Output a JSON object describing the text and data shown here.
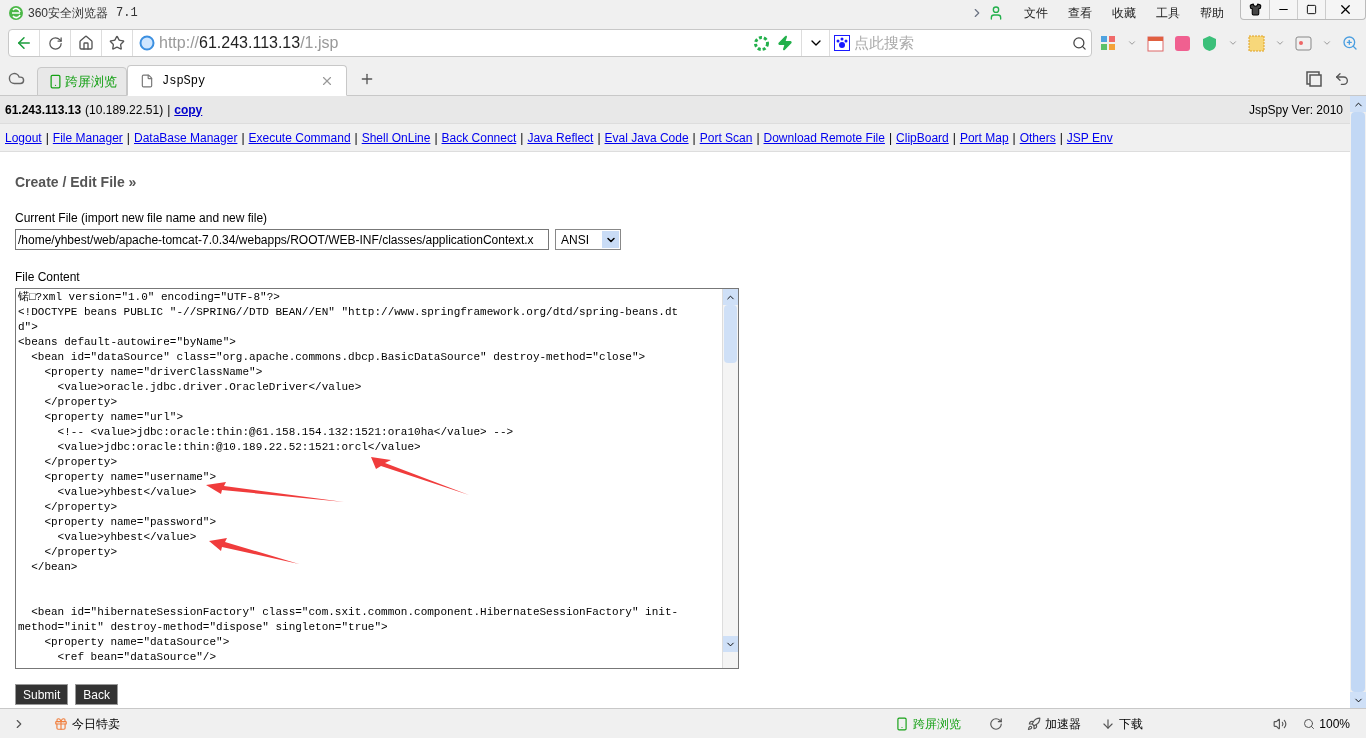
{
  "window": {
    "title": "360安全浏览器",
    "version": "7.1",
    "menu": [
      "文件",
      "查看",
      "收藏",
      "工具",
      "帮助"
    ]
  },
  "address_bar": {
    "scheme": "http://",
    "host": "61.243.113.13",
    "path": "/1.jsp"
  },
  "search": {
    "placeholder": "点此搜索"
  },
  "tabs": [
    {
      "label": "跨屏浏览",
      "kind": "cross",
      "selected": false
    },
    {
      "label": "JspSpy",
      "kind": "page",
      "selected": true
    }
  ],
  "page": {
    "header": {
      "host": "61.243.113.13",
      "ip": "(10.189.22.51)",
      "separator": "|",
      "copy_link": "copy",
      "version": "JspSpy Ver: 2010"
    },
    "nav_links": [
      "Logout",
      "File Manager",
      "DataBase Manager",
      "Execute Command",
      "Shell OnLine",
      "Back Connect",
      "Java Reflect",
      "Eval Java Code",
      "Port Scan",
      "Download Remote File",
      "ClipBoard",
      "Port Map",
      "Others",
      "JSP Env"
    ],
    "nav_separator": "|",
    "form": {
      "title": "Create / Edit File »",
      "file_label": "Current File (import new file name and new file)",
      "file_value": "/home/yhbest/web/apache-tomcat-7.0.34/webapps/ROOT/WEB-INF/classes/applicationContext.x",
      "encoding": "ANSI",
      "content_label": "File Content",
      "content_blocks": [
        [
          "锘□?xml version=\"1.0\" encoding=\"UTF-8\"?>",
          "<!DOCTYPE beans PUBLIC \"-//SPRING//DTD BEAN//EN\" \"http://www.springframework.org/dtd/spring-beans.dt",
          "d\">",
          "<beans default-autowire=\"byName\">",
          "  <bean id=\"dataSource\" class=\"org.apache.commons.dbcp.BasicDataSource\" destroy-method=\"close\">",
          "    <property name=\"driverClassName\">",
          "      <value>oracle.jdbc.driver.OracleDriver</value>",
          "    </property>",
          "    <property name=\"url\">",
          "      <!-- <value>jdbc:oracle:thin:@61.158.154.132:1521:ora10ha</value> -->",
          "      <value>jdbc:oracle:thin:@10.189.22.52:1521:orcl</value>",
          "    </property>",
          "    <property name=\"username\">",
          "      <value>yhbest</value>",
          "    </property>",
          "    <property name=\"password\">",
          "      <value>yhbest</value>",
          "    </property>",
          "  </bean>"
        ],
        [
          "  <bean id=\"hibernateSessionFactory\" class=\"com.sxit.common.component.HibernateSessionFactory\" init-",
          "method=\"init\" destroy-method=\"dispose\" singleton=\"true\">",
          "    <property name=\"dataSource\">",
          "      <ref bean=\"dataSource\"/>"
        ]
      ],
      "buttons": [
        "Submit",
        "Back"
      ]
    }
  },
  "status_bar": {
    "deals": "今日特卖",
    "cross": "跨屏浏览",
    "accelerator": "加速器",
    "download": "下载",
    "zoom": "100%"
  }
}
